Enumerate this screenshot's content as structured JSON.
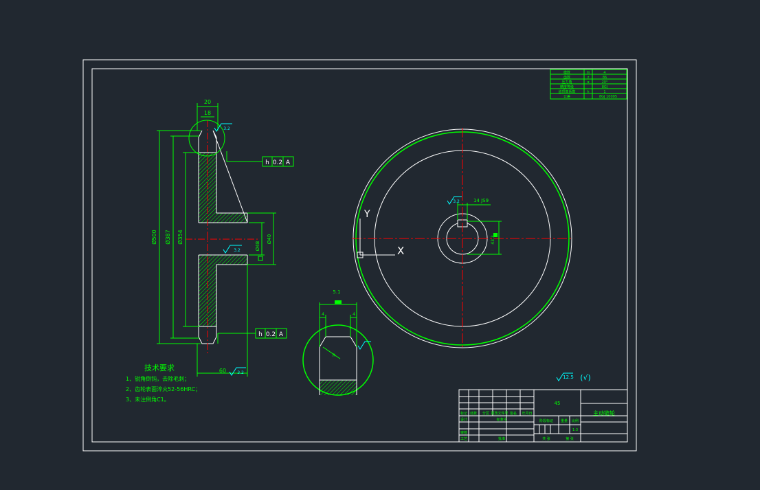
{
  "colors": {
    "background": "#212830",
    "outline": "#ffffff",
    "dimension": "#00ff00",
    "centerline": "#ff0000",
    "annotation": "#00ffff",
    "hatch": "#00ff00"
  },
  "drawing": {
    "side_view": {
      "dims": {
        "top_width": "20",
        "top_inner": "18",
        "outer_dia": "Ø500",
        "root_dia": "Ø387",
        "pitch_dia": "Ø354",
        "hub_len": "60",
        "bore": "Ø40",
        "keyway": "Ø48",
        "roughness_top": "3.2",
        "roughness_bore": "3.2",
        "roughness_bottom": "3.2"
      },
      "tolerance_top": {
        "datum": "h",
        "value": "0.2",
        "ref": "A"
      },
      "tolerance_bottom": {
        "datum": "h",
        "value": "0.2",
        "ref": "A"
      }
    },
    "detail_view": {
      "dims": {
        "top": "5.1",
        "left": "4",
        "right": "4",
        "radius": "R"
      }
    },
    "front_view": {
      "dims": {
        "keyway_width": "14 JS9",
        "keyway_depth": "43.3",
        "roughness": "3.2"
      },
      "ucs": {
        "y": "Y",
        "x": "X"
      }
    },
    "general_roughness": "12.5",
    "general_roughness_check": "(√)"
  },
  "tech_requirements": {
    "title": "技术要求",
    "items": [
      "1、锐角倒钝，去除毛刺；",
      "2、齿轮表面淬火52-56HRC；",
      "3、未注倒角C1。"
    ]
  },
  "gear_params": {
    "rows": [
      [
        "模数",
        "m",
        "4"
      ],
      [
        "齿数",
        "z",
        "86"
      ],
      [
        "压力角",
        "α",
        "20°"
      ],
      [
        "精度等级",
        "",
        "8GJ"
      ],
      [
        "齿顶高系数",
        "h",
        "1"
      ],
      [
        "公差",
        "",
        "8GJ 10095"
      ]
    ]
  },
  "title_block": {
    "material": "45",
    "part_name": "主动链轮",
    "labels": {
      "design": "设计",
      "check": "审核",
      "process": "工艺",
      "approve": "批准",
      "mark": "标记",
      "count": "处数",
      "zone": "分区",
      "change_doc": "更改文件号",
      "signature": "签名",
      "date": "年月日",
      "stage_mark": "阶段标记",
      "weight": "重量",
      "scale": "比例",
      "scale_value": "1:3",
      "sheet_total": "共  张",
      "sheet_n": "第  张",
      "standardize": "标准化"
    }
  }
}
